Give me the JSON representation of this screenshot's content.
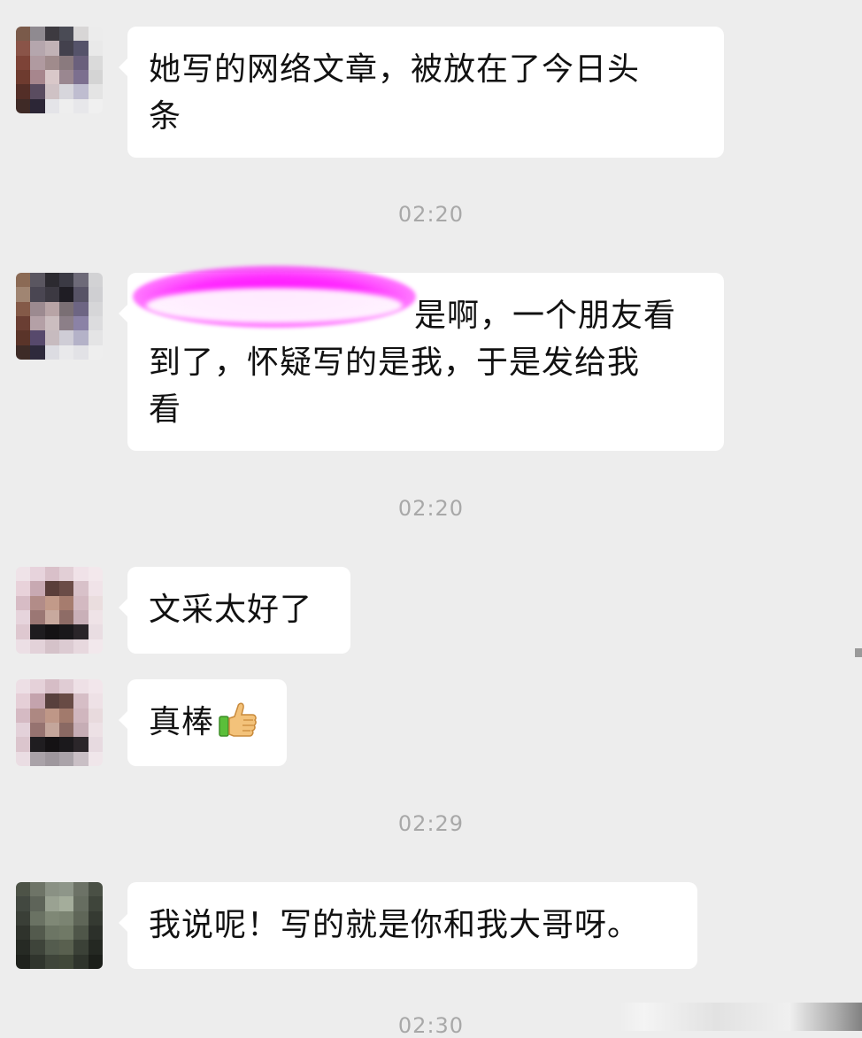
{
  "messages": [
    {
      "text": "她写的网络文章，被放在了今日头条",
      "line1": "她写的网络文章，被放在了今日头",
      "line2": "条"
    },
    {
      "line1": "是啊，一个朋友看",
      "line2": "到了，怀疑写的是我，于是发给我",
      "line3": "看"
    },
    {
      "text": "文采太好了"
    },
    {
      "text": "真棒"
    },
    {
      "text": "我说呢！写的就是你和我大哥呀。"
    }
  ],
  "timestamps": [
    "02:20",
    "02:20",
    "02:29",
    "02:30"
  ],
  "colors": {
    "background": "#ededed",
    "bubble": "#ffffff",
    "text": "#111111",
    "timestamp": "#a8a8a8",
    "redaction": "#ff00ff"
  },
  "icons": {
    "thumbs_up": "thumbs-up-emoji-icon"
  }
}
